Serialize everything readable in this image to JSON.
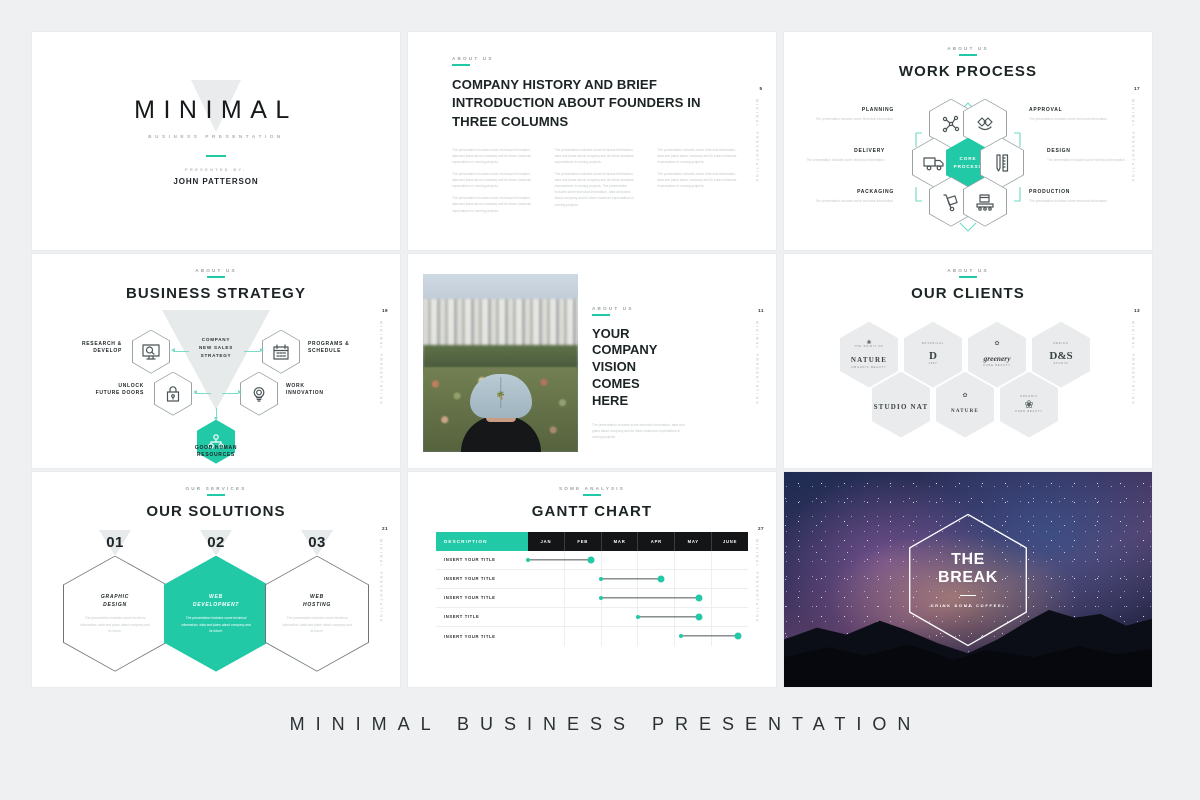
{
  "footer": {
    "text": "MINIMAL BUSINESS PRESENTATION"
  },
  "theme": {
    "accent": "#21c9a6",
    "ink": "#1d2426",
    "muted": "#c3c9cb",
    "panel": "#e9ebec"
  },
  "slides": {
    "title": {
      "name": "MINIMAL",
      "subtitle": "BUSINESS PRESENTATION",
      "presented_by_label": "PRESENTED BY:",
      "presenter": "JOHN PATTERSON"
    },
    "history": {
      "eyebrow": "ABOUT US",
      "heading": "COMPANY HISTORY AND BRIEF INTRODUCTION ABOUT FOUNDERS IN THREE COLUMNS",
      "page": "5",
      "side_text": "MINIMAL PRESENTATION",
      "columns": [
        {
          "paragraphs": [
            "The presentation includes some technical information, data and plans about company and its future business expectations in coming projects.",
            "The presentation includes some technical information, data and plans about company and its future business expectations in coming projects.",
            "The presentation includes some technical information, data and plans about company and its future business expectations in coming projects."
          ]
        },
        {
          "paragraphs": [
            "The presentation includes some technical information, data and plans about company and its future business expectations in coming projects.",
            "The presentation includes some technical information, data and plans about company and its future business expectations in coming projects. The presentation includes some technical information, data and plans about company and its future business expectations in coming projects."
          ]
        },
        {
          "paragraphs": [
            "The presentation includes some technical information, data and plans about company and its future business expectations in coming projects.",
            "The presentation includes some technical information, data and plans about company and its future business expectations in coming projects."
          ]
        }
      ]
    },
    "work_process": {
      "eyebrow": "ABOUT US",
      "title": "WORK PROCESS",
      "page": "17",
      "side_text": "MINIMAL PRESENTATION",
      "core": "CORE\nPROCESS",
      "core_line1": "CORE",
      "core_line2": "PROCESS",
      "steps": [
        {
          "label": "PLANNING",
          "desc": "The presentation includes some technical information.",
          "icon": "network-icon"
        },
        {
          "label": "APPROVAL",
          "desc": "The presentation includes some technical information.",
          "icon": "handshake-icon"
        },
        {
          "label": "DELIVERY",
          "desc": "The presentation includes some technical information.",
          "icon": "truck-icon"
        },
        {
          "label": "DESIGN",
          "desc": "The presentation includes some technical information.",
          "icon": "pencil-ruler-icon"
        },
        {
          "label": "PACKAGING",
          "desc": "The presentation includes some technical information.",
          "icon": "hand-truck-icon"
        },
        {
          "label": "PRODUCTION",
          "desc": "The presentation includes some technical information.",
          "icon": "conveyor-icon"
        }
      ]
    },
    "strategy": {
      "eyebrow": "ABOUT US",
      "title": "BUSINESS STRATEGY",
      "page": "19",
      "side_text": "MINIMAL PRESENTATION",
      "center_line1": "COMPANY",
      "center_line2": "NEW SALES",
      "center_line3": "STRATEGY",
      "nodes": [
        {
          "label": "RESEARCH &\nDEVELOP",
          "l1": "RESEARCH &",
          "l2": "DEVELOP",
          "icon": "monitor-search-icon"
        },
        {
          "label": "PROGRAMS &\nSCHEDULE",
          "l1": "PROGRAMS &",
          "l2": "SCHEDULE",
          "icon": "calendar-icon"
        },
        {
          "label": "UNLOCK\nFUTURE DOORS",
          "l1": "UNLOCK",
          "l2": "FUTURE DOORS",
          "icon": "lock-icon"
        },
        {
          "label": "WORK\nINNOVATION",
          "l1": "WORK",
          "l2": "INNOVATION",
          "icon": "lightbulb-icon"
        }
      ],
      "bottom_l1": "GOOD HUMAN",
      "bottom_l2": "RESOURCES",
      "bottom_icon": "org-chart-icon"
    },
    "vision": {
      "eyebrow": "ABOUT US",
      "heading_lines": [
        "YOUR",
        "COMPANY",
        "VISION",
        "COMES",
        "HERE"
      ],
      "page": "11",
      "side_text": "MINIMAL PRESENTATION",
      "body": "The presentation includes some technical information, data and plans about company and its future business expectations in coming projects.",
      "photo_alt": "person-in-cap-photo"
    },
    "clients": {
      "eyebrow": "ABOUT US",
      "title": "OUR CLIENTS",
      "page": "13",
      "side_text": "MINIMAL PRESENTATION",
      "logos": [
        {
          "top": "THE SPIRIT OF",
          "main": "NATURE",
          "bottom": "ORGANIC BEAUTY",
          "style": "serif"
        },
        {
          "top": "BOTANICAL",
          "main": "D",
          "bottom": "1987",
          "style": "monogram"
        },
        {
          "top": "THE",
          "main": "greenery",
          "bottom": "PURE BEAUTY",
          "style": "script"
        },
        {
          "top": "DESIGN",
          "main": "D&S",
          "bottom": "STUDIO",
          "style": "box"
        },
        {
          "top": "",
          "main": "STUDIO NAT",
          "bottom": "",
          "style": "stack"
        },
        {
          "top": "",
          "main": "NATURE",
          "bottom": "",
          "style": "vertical"
        },
        {
          "top": "ORGANIC",
          "main": "leaf",
          "bottom": "PURE BEAUTY",
          "style": "badge"
        }
      ]
    },
    "solutions": {
      "eyebrow": "OUR SERVICES",
      "title": "OUR SOLUTIONS",
      "page": "21",
      "side_text": "MINIMAL PRESENTATION",
      "cards": [
        {
          "num": "01",
          "l1": "GRAPHIC",
          "l2": "DESIGN",
          "desc": "The presentation includes some technical information, data and plans about company and its future.",
          "highlight": false
        },
        {
          "num": "02",
          "l1": "WEB",
          "l2": "DEVELOPMENT",
          "desc": "The presentation includes some technical information, data and plans about company and its future.",
          "highlight": true
        },
        {
          "num": "03",
          "l1": "WEB",
          "l2": "HOSTING",
          "desc": "The presentation includes some technical information, data and plans about company and its future.",
          "highlight": false
        }
      ]
    },
    "gantt": {
      "eyebrow": "SOME ANALYSIS",
      "title": "GANTT CHART",
      "page": "27",
      "side_text": "MINIMAL PRESENTATION"
    },
    "break": {
      "title_line1": "THE",
      "title_line2": "BREAK",
      "subtitle": "DRINK SOME COFFEE!",
      "photo_alt": "night-sky-mountains-photo"
    }
  },
  "chart_data": {
    "type": "bar",
    "title": "GANTT CHART",
    "subtitle": "SOME ANALYSIS",
    "orientation": "horizontal",
    "description_header": "DESCRIPTION",
    "categories": [
      "JAN",
      "FEB",
      "MAR",
      "APR",
      "MAY",
      "JUNE"
    ],
    "xlabel": "",
    "ylabel": "",
    "grid": true,
    "legend": "none",
    "rows": [
      {
        "label": "INSERT YOUR TITLE",
        "start_month": "JAN",
        "end_month": "FEB",
        "start_index": 0,
        "end_index": 1.72
      },
      {
        "label": "INSERT YOUR TITLE",
        "start_month": "MAR",
        "end_month": "APR",
        "start_index": 2,
        "end_index": 3.62
      },
      {
        "label": "INSERT YOUR TITLE",
        "start_month": "MAR",
        "end_month": "MAY",
        "start_index": 2,
        "end_index": 4.66
      },
      {
        "label": "INSERT TITLE",
        "start_month": "APR",
        "end_month": "MAY",
        "start_index": 3,
        "end_index": 4.66
      },
      {
        "label": "INSERT YOUR TITLE",
        "start_month": "MAY",
        "end_month": "JUNE",
        "start_index": 4.18,
        "end_index": 5.72
      }
    ]
  }
}
